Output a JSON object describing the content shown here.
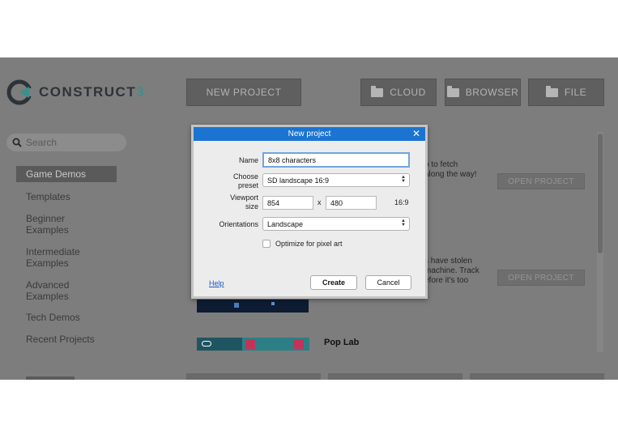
{
  "app": {
    "brand": "CONSTRUCT",
    "brand_version": "3"
  },
  "toolbar": {
    "new_project": "NEW PROJECT",
    "cloud": "CLOUD",
    "browser": "BROWSER",
    "file": "FILE"
  },
  "search": {
    "placeholder": "Search"
  },
  "sidebar": {
    "items": [
      {
        "label": "Game Demos",
        "active": true
      },
      {
        "label": "Templates"
      },
      {
        "label": "Beginner\nExamples"
      },
      {
        "label": "Intermediate\nExamples"
      },
      {
        "label": "Advanced\nExamples"
      },
      {
        "label": "Tech Demos"
      },
      {
        "label": "Recent Projects"
      }
    ]
  },
  "content": {
    "open_project_1": "OPEN PROJECT",
    "open_project_2": "OPEN PROJECT",
    "desc_1": "o to fetch\nalong the way!",
    "desc_2": "s have stolen\nmachine. Track\nefore it's too",
    "pop_lab": "Pop Lab"
  },
  "dialog": {
    "title": "New project",
    "name_label": "Name",
    "name_value": "8x8 characters",
    "preset_label": "Choose\npreset",
    "preset_value": "SD landscape 16:9",
    "viewport_label": "Viewport\nsize",
    "viewport_width": "854",
    "viewport_x": "x",
    "viewport_height": "480",
    "aspect": "16:9",
    "orientations_label": "Orientations",
    "orientations_value": "Landscape",
    "pixel_art_label": "Optimize for pixel art",
    "pixel_art_checked": false,
    "help": "Help",
    "create": "Create",
    "cancel": "Cancel"
  },
  "colors": {
    "titlebar": "#1b74d1",
    "overlay": "#7d7d7d",
    "brand_accent": "#3d8f8a"
  },
  "icons": {
    "logo": "construct-logo-icon",
    "search": "search-icon",
    "folder": "folder-icon",
    "close": "close-icon",
    "select_arrows": "chevron-updown-icon"
  }
}
